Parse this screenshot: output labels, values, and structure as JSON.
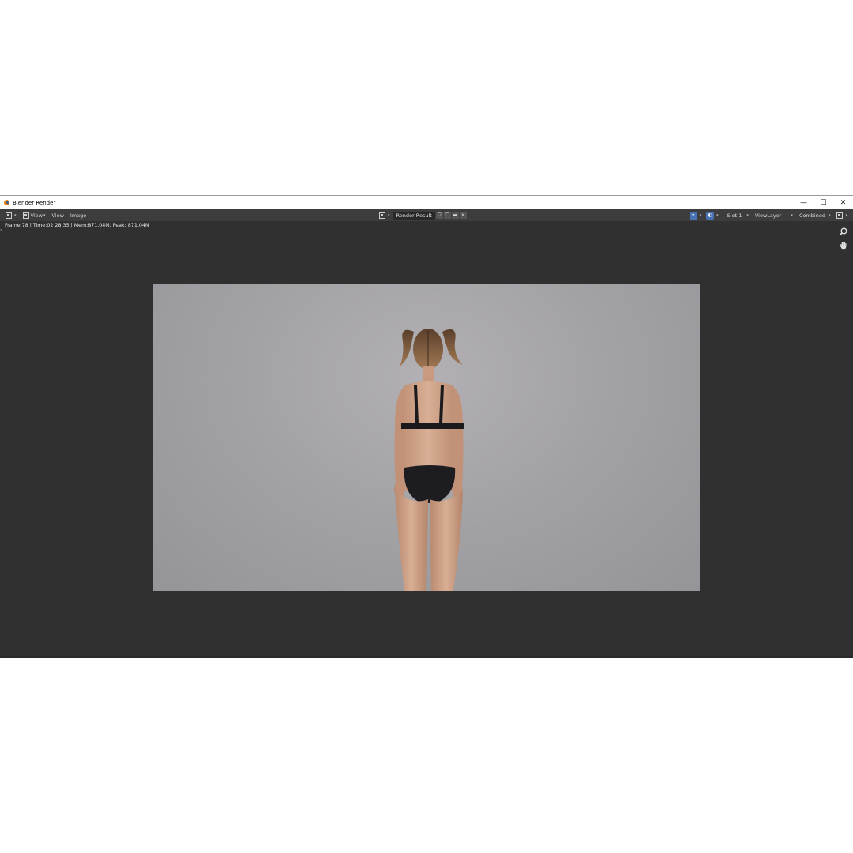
{
  "window": {
    "title": "Blender Render",
    "controls": {
      "minimize": "—",
      "maximize": "☐",
      "close": "✕"
    }
  },
  "header": {
    "menus": [
      "View",
      "View",
      "Image"
    ],
    "image_name": "Render Result",
    "slot": "Slot 1",
    "view_layer": "ViewLayer",
    "pass": "Combined"
  },
  "render_info": "Frame:78 | Time:02:28.35 | Mem:871.04M, Peak: 871.04M",
  "icons": {
    "editor_type": "image-editor-icon",
    "zoom": "zoom-icon",
    "pan": "hand-icon"
  },
  "colors": {
    "panel_bg": "#303030",
    "header_bg": "#3d3d3d",
    "accent_blue": "#4772b3",
    "blender_orange": "#e87d0d"
  }
}
